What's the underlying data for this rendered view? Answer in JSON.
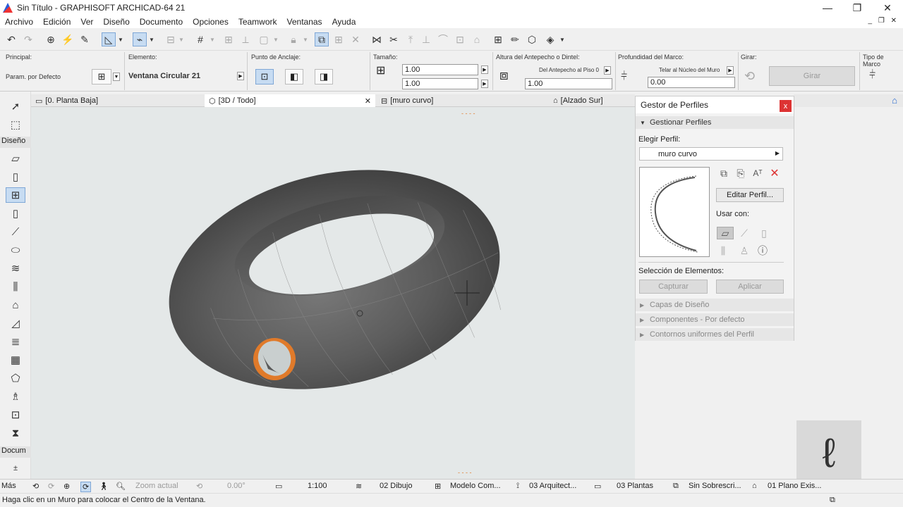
{
  "window": {
    "title": "Sin Título - GRAPHISOFT ARCHICAD-64 21"
  },
  "menu": [
    "Archivo",
    "Edición",
    "Ver",
    "Diseño",
    "Documento",
    "Opciones",
    "Teamwork",
    "Ventanas",
    "Ayuda"
  ],
  "infobox": {
    "principal_label": "Principal:",
    "principal_value": "Param. por Defecto",
    "element_label": "Elemento:",
    "element_value": "Ventana Circular 21",
    "anchor_label": "Punto de Anclaje:",
    "size_label": "Tamaño:",
    "width": "1.00",
    "height": "1.00",
    "sill_label": "Altura del Antepecho o Dintel:",
    "sill_ref": "Del Antepecho al Piso 0",
    "sill_value": "1.00",
    "frame_label": "Profundidad del Marco:",
    "frame_ref": "Telar al Núcleo del Muro",
    "frame_value": "0.00",
    "rotate_label": "Girar:",
    "rotate_button": "Girar",
    "type_label": "Tipo de Marco"
  },
  "toolbox": {
    "group_design": "Diseño",
    "group_doc": "Docum",
    "more": "Más"
  },
  "tabs": [
    {
      "label": "[0. Planta Baja]"
    },
    {
      "label": "[3D / Todo]"
    },
    {
      "label": "[muro curvo]"
    },
    {
      "label": "[Alzado Sur]"
    }
  ],
  "panel": {
    "title": "Gestor de Perfiles",
    "section_manage": "Gestionar Perfiles",
    "choose_label": "Elegir Perfil:",
    "profile_name": "muro curvo",
    "edit_button": "Editar Perfil...",
    "use_with": "Usar con:",
    "selection_label": "Selección de Elementos:",
    "capture_button": "Capturar",
    "apply_button": "Aplicar",
    "sections": [
      "Capas de Diseño",
      "Componentes - Por defecto",
      "Contornos uniformes del Perfil"
    ]
  },
  "status": {
    "zoom": "Zoom actual",
    "angle": "0.00°",
    "scale": "1:100",
    "layer_combo": "02 Dibujo",
    "model_view": "Modelo Com...",
    "pen_set": "03 Arquitect...",
    "dim_std": "03 Plantas",
    "override": "Sin Sobrescri...",
    "renovation": "01 Plano Exis..."
  },
  "hint": "Haga clic en un Muro para colocar el Centro de la Ventana.",
  "colors": {
    "accent": "#c7dcf2",
    "window_frame": "#e07a2a",
    "close_red": "#d33333"
  }
}
